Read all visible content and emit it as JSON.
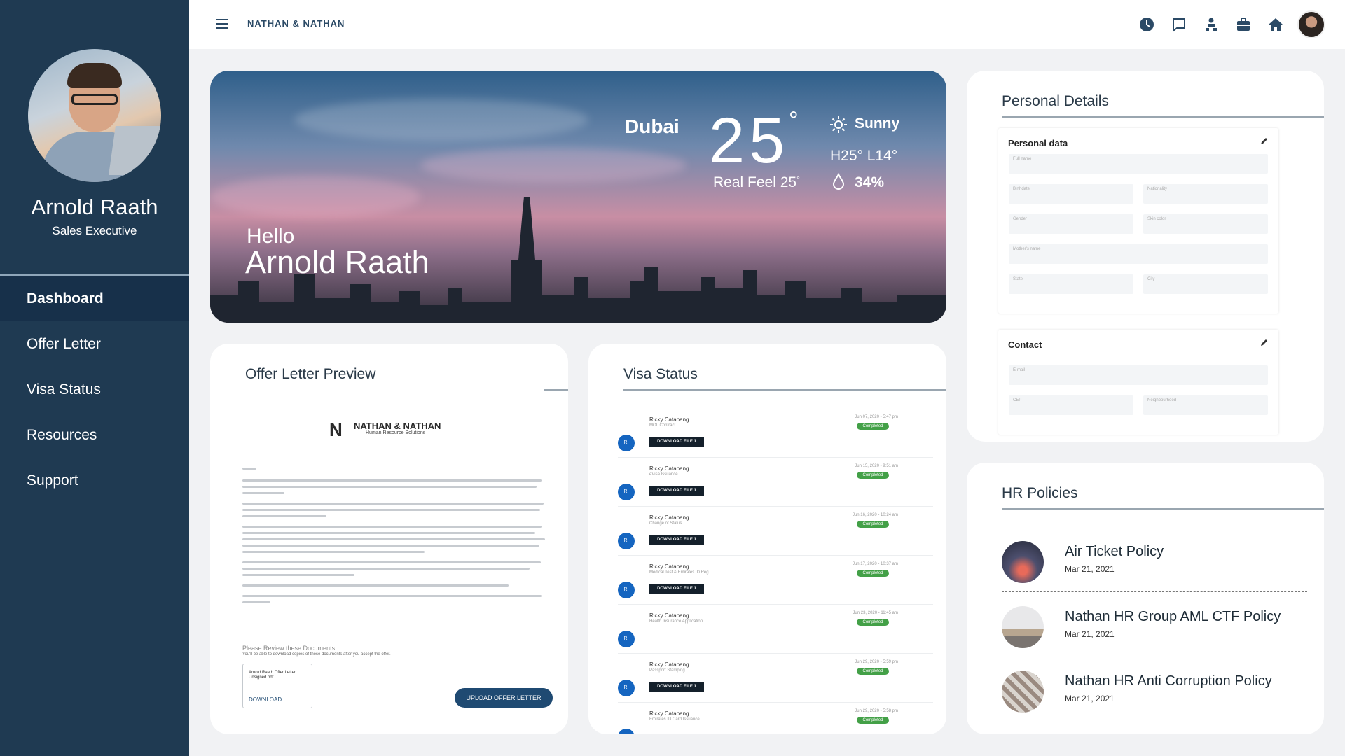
{
  "app": {
    "brand": "NATHAN & NATHAN"
  },
  "user": {
    "name": "Arnold Raath",
    "role": "Sales Executive"
  },
  "sidebar": {
    "items": [
      {
        "label": "Dashboard",
        "active": true
      },
      {
        "label": "Offer Letter",
        "active": false
      },
      {
        "label": "Visa Status",
        "active": false
      },
      {
        "label": "Resources",
        "active": false
      },
      {
        "label": "Support",
        "active": false
      }
    ]
  },
  "topbar": {
    "icons": [
      "clock-icon",
      "chat-icon",
      "org-chart-icon",
      "briefcase-icon",
      "home-icon",
      "user-avatar"
    ]
  },
  "hero": {
    "greeting": "Hello",
    "name": "Arnold Raath",
    "weather": {
      "city": "Dubai",
      "temp": "25",
      "degree": "°",
      "feel_label": "Real Feel 25",
      "feel_degree": "°",
      "condition": "Sunny",
      "high_low": "H25° L14°",
      "humidity": "34%"
    }
  },
  "offer_letter": {
    "title": "Offer Letter Preview",
    "logo_text": "NATHAN & NATHAN",
    "logo_sub": "Human Resource Solutions",
    "review_title": "Please Review these Documents",
    "review_sub": "You'll be able to download copies of these documents after you accept the offer.",
    "file_name": "Arnold Raath Offer Letter Unsigned.pdf",
    "download_label": "DOWNLOAD",
    "upload_label": "UPLOAD OFFER LETTER"
  },
  "visa": {
    "title": "Visa Status",
    "download_label": "DOWNLOAD FILE 1",
    "rows": [
      {
        "initials": "RI",
        "name": "Ricky Catapang",
        "doc": "MOL Contract",
        "date": "Jun 07, 2020 - 5:47 pm",
        "status": "Completed",
        "has_download": true
      },
      {
        "initials": "RI",
        "name": "Ricky Catapang",
        "doc": "eVisa Issuance",
        "date": "Jun 15, 2020 - 9:51 am",
        "status": "Completed",
        "has_download": true
      },
      {
        "initials": "RI",
        "name": "Ricky Catapang",
        "doc": "Change of Status",
        "date": "Jun 16, 2020 - 10:24 am",
        "status": "Completed",
        "has_download": true
      },
      {
        "initials": "RI",
        "name": "Ricky Catapang",
        "doc": "Medical Test & Emirates ID Reg",
        "date": "Jun 17, 2020 - 10:37 am",
        "status": "Completed",
        "has_download": true
      },
      {
        "initials": "RI",
        "name": "Ricky Catapang",
        "doc": "Health Insurance Application",
        "date": "Jun 23, 2020 - 11:45 am",
        "status": "Completed",
        "has_download": false
      },
      {
        "initials": "RI",
        "name": "Ricky Catapang",
        "doc": "Passport Stamping",
        "date": "Jun 29, 2020 - 5:59 pm",
        "status": "Completed",
        "has_download": true
      },
      {
        "initials": "RI",
        "name": "Ricky Catapang",
        "doc": "Emirates ID Card Issuance",
        "date": "Jun 29, 2020 - 5:58 pm",
        "status": "Completed",
        "has_download": false
      }
    ]
  },
  "personal": {
    "title": "Personal Details",
    "data_title": "Personal data",
    "contact_title": "Contact",
    "fields": {
      "full_name": "Full name",
      "birthdate": "Birthdate",
      "nationality": "Nationality",
      "gender": "Gender",
      "skin_color": "Skin color",
      "mothers_name": "Mother's name",
      "state": "State",
      "city": "City",
      "email": "E-mail",
      "cep": "CEP",
      "neighbourhood": "Neighbourhood"
    }
  },
  "hr": {
    "title": "HR Policies",
    "items": [
      {
        "title": "Air Ticket Policy",
        "date": "Mar 21, 2021"
      },
      {
        "title": "Nathan HR Group AML CTF Policy",
        "date": "Mar 21, 2021"
      },
      {
        "title": "Nathan HR Anti Corruption Policy",
        "date": "Mar 21, 2021"
      }
    ]
  }
}
